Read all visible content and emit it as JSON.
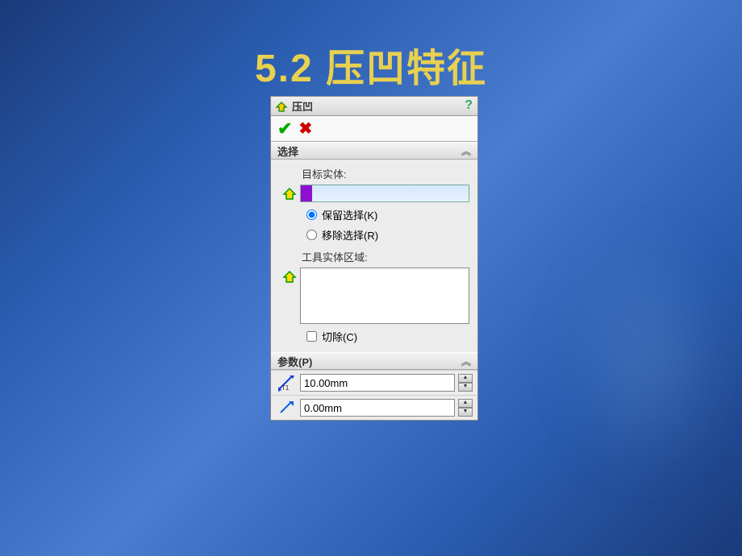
{
  "slide": {
    "title": "5.2  压凹特征"
  },
  "panel": {
    "title": "压凹",
    "help": "?"
  },
  "sections": {
    "selection": {
      "header": "选择",
      "target_label": "目标实体:",
      "keep_label": "保留选择(K)",
      "remove_label": "移除选择(R)",
      "tool_label": "工具实体区域:",
      "cut_label": "切除(C)"
    },
    "params": {
      "header": "参数(P)",
      "t1_label": "T1",
      "t1_value": "10.00mm",
      "t2_value": "0.00mm"
    }
  }
}
